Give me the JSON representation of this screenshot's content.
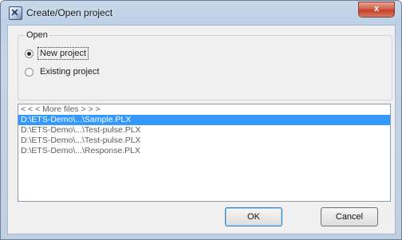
{
  "window": {
    "title": "Create/Open project",
    "close_label": "x"
  },
  "open_group": {
    "legend": "Open",
    "options": [
      {
        "label": "New project",
        "checked": true
      },
      {
        "label": "Existing project",
        "checked": false
      }
    ]
  },
  "file_list": {
    "items": [
      "< < < More files > > >",
      "D:\\ETS-Demo\\...\\Sample.PLX",
      "D:\\ETS-Demo\\...\\Test-pulse.PLX",
      "D:\\ETS-Demo\\...\\Test-pulse.PLX",
      "D:\\ETS-Demo\\...\\Response.PLX"
    ],
    "selected_index": 1
  },
  "buttons": {
    "ok": "OK",
    "cancel": "Cancel"
  }
}
